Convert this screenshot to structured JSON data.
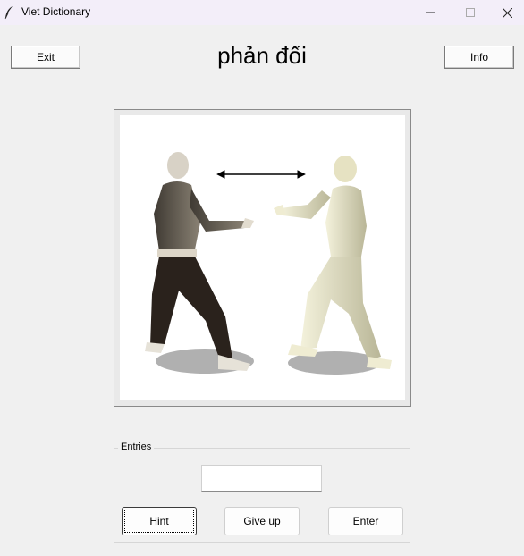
{
  "window": {
    "title": "Viet Dictionary"
  },
  "toolbar": {
    "exit_label": "Exit",
    "info_label": "Info"
  },
  "word": {
    "text": "phản đối"
  },
  "entries": {
    "label": "Entries",
    "input_value": "",
    "hint_label": "Hint",
    "giveup_label": "Give up",
    "enter_label": "Enter"
  }
}
